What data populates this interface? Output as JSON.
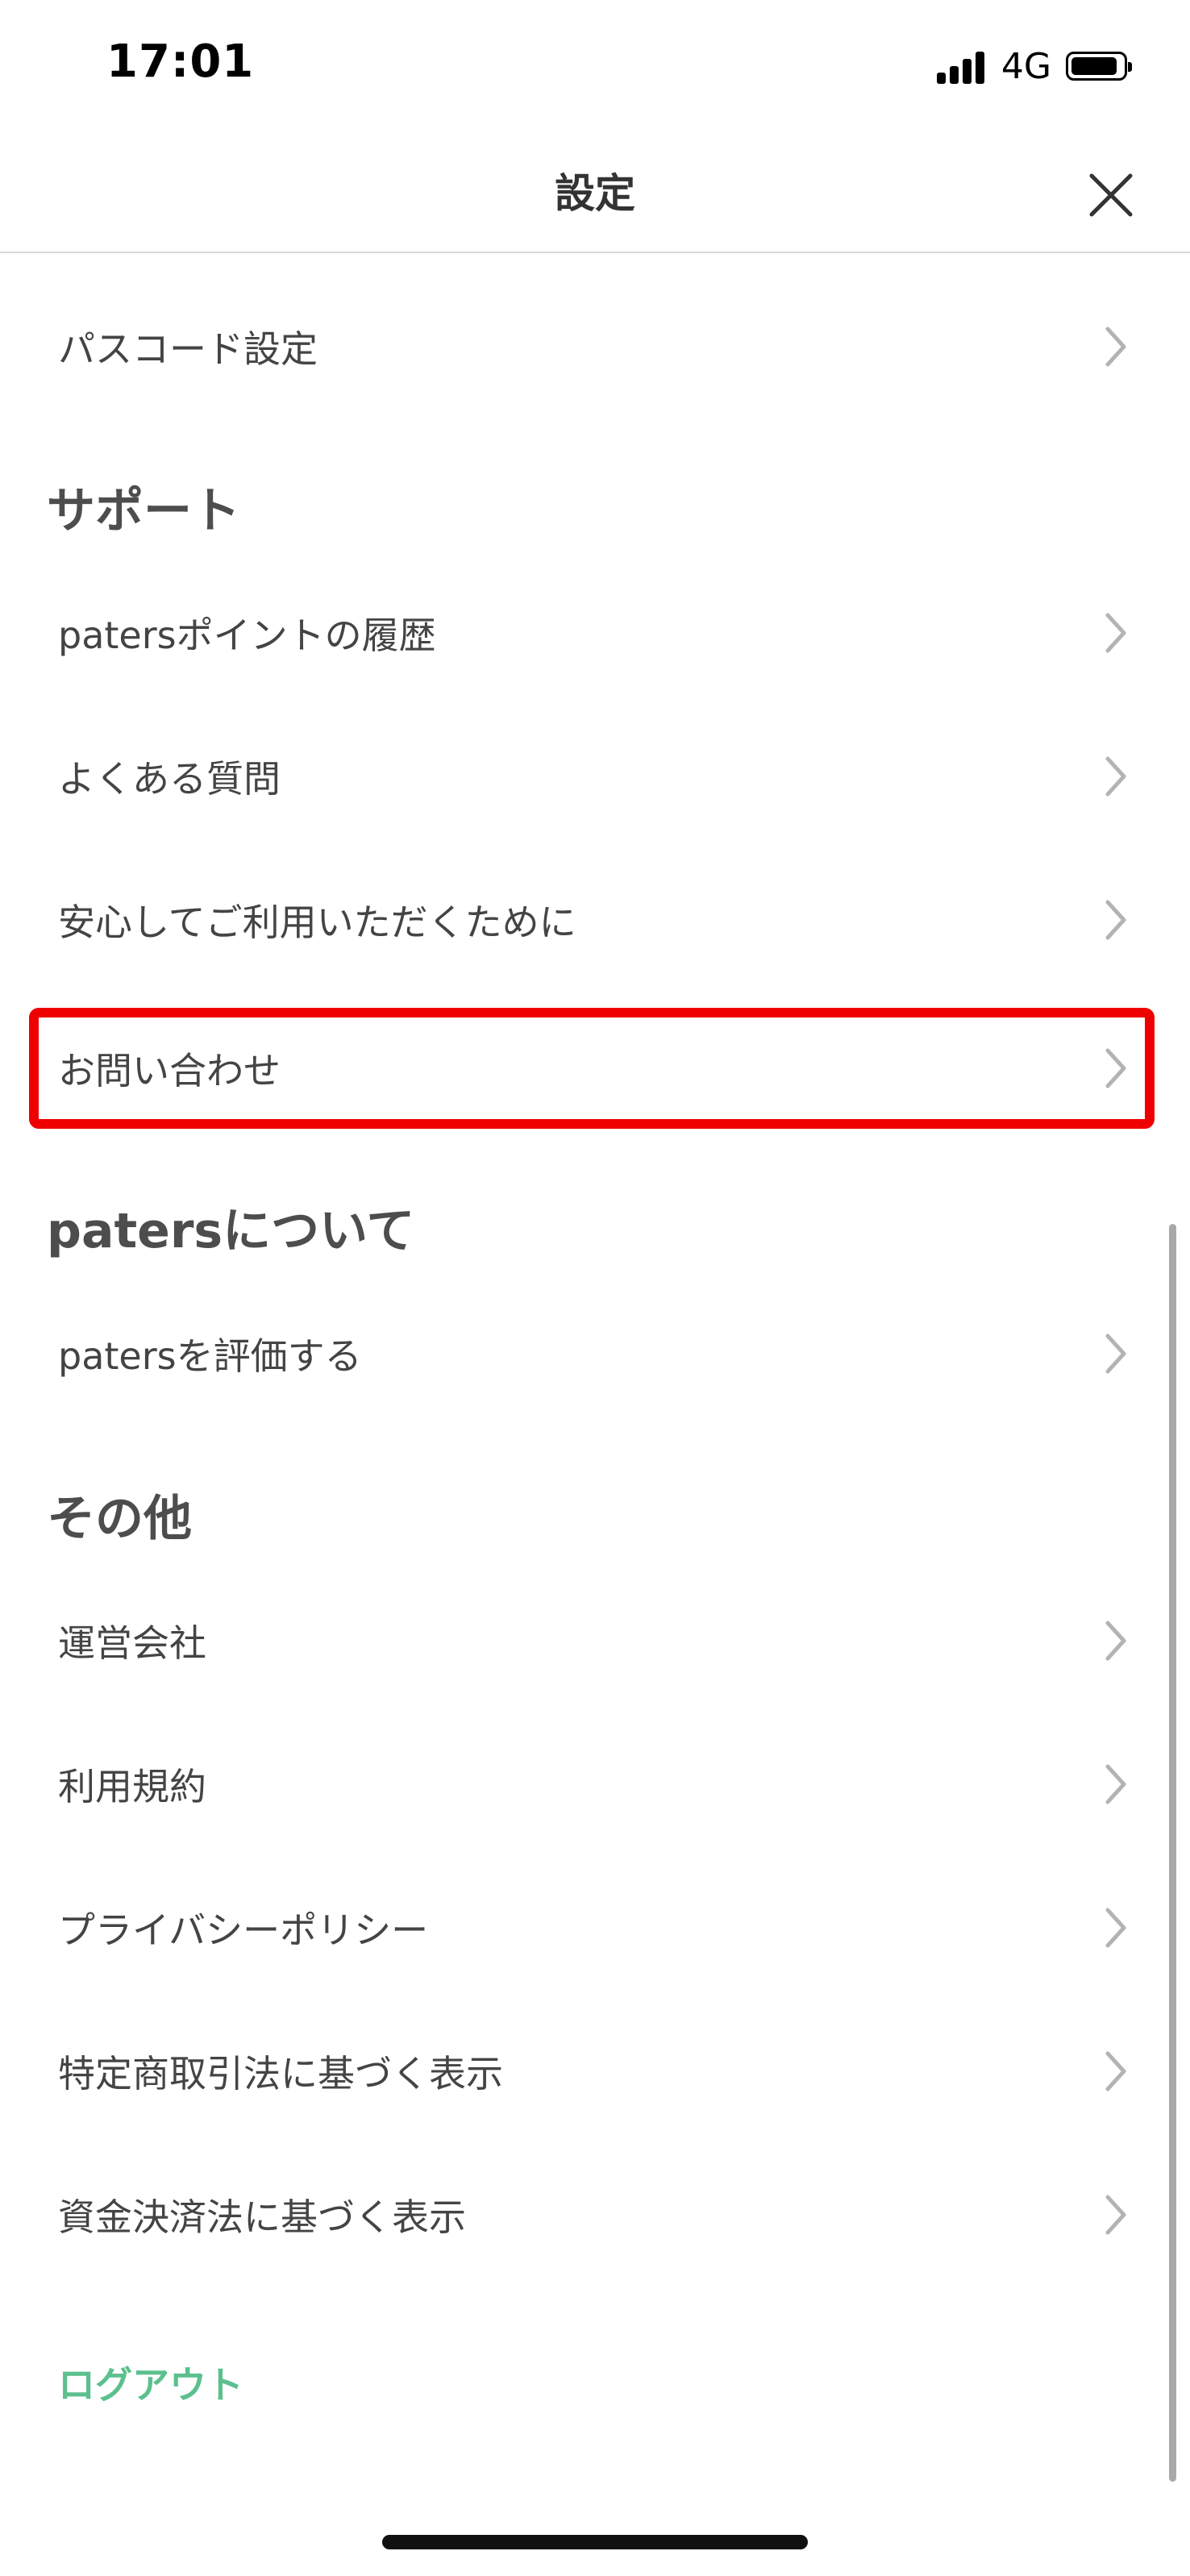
{
  "status_bar": {
    "time": "17:01",
    "network": "4G"
  },
  "header": {
    "title": "設定",
    "close_icon": "close-icon"
  },
  "rows": {
    "passcode": "パスコード設定",
    "points_history": "patersポイントの履歴",
    "faq": "よくある質問",
    "safety": "安心してご利用いただくために",
    "contact": "お問い合わせ",
    "rate_app": "patersを評価する",
    "company": "運営会社",
    "terms": "利用規約",
    "privacy": "プライバシーポリシー",
    "tokushoho": "特定商取引法に基づく表示",
    "shikin": "資金決済法に基づく表示"
  },
  "sections": {
    "support": "サポート",
    "about": "patersについて",
    "other": "その他"
  },
  "logout_label": "ログアウト",
  "colors": {
    "accent": "#5cc08e",
    "highlight": "#ee0000",
    "text": "#444444"
  }
}
